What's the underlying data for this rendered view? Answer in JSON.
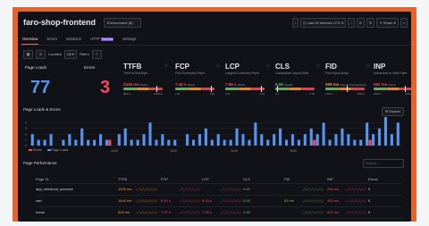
{
  "header": {
    "title": "faro-shop-frontend",
    "environment": "Environment (8)",
    "time_range": "Last 30 minutes",
    "time_zone": "UTC",
    "zoom_label": "−",
    "share_label": "Share",
    "close_label": "×"
  },
  "tabs": [
    {
      "label": "Overview",
      "active": true
    },
    {
      "label": "Errors",
      "active": false
    },
    {
      "label": "Sessions",
      "active": false
    },
    {
      "label": "HTTP",
      "active": false,
      "badge": "Preview"
    },
    {
      "label": "Settings",
      "active": false
    }
  ],
  "filters": {
    "location_label": "Location",
    "location_value": "All",
    "filters_label": "Filters",
    "add_label": "+"
  },
  "summary": {
    "page_loads_label": "Page Loads",
    "page_loads_value": "77",
    "errors_label": "Errors",
    "errors_value": "3"
  },
  "vitals": [
    {
      "name": "TTFB",
      "subtitle": "Time to First Byte",
      "value": "2436 ms",
      "note": "(Poor)",
      "color": "#f2495c",
      "level": 0.85,
      "t1": "800ms",
      "t2": "1800ms"
    },
    {
      "name": "FCP",
      "subtitle": "First Contentful Paint",
      "value": "7.46 s",
      "note": "(Poor)",
      "color": "#f2495c",
      "level": 0.9,
      "t1": "1.8s",
      "t2": "3.0s"
    },
    {
      "name": "LCP",
      "subtitle": "Largest Contentful Paint",
      "value": "7.89 s",
      "note": "(Poor)",
      "color": "#f2495c",
      "level": 0.9,
      "t1": "2.5s",
      "t2": "4.0s"
    },
    {
      "name": "CLS",
      "subtitle": "Cumulative Layout Shift",
      "value": "0.00",
      "note": "(Good)",
      "color": "#73bf69",
      "level": 0.05,
      "t1": "0.1",
      "t2": "0.25"
    },
    {
      "name": "FID",
      "subtitle": "First Input Delay",
      "value": "209 ms",
      "note": "(Needs Improvement)",
      "color": "#ff9830",
      "level": 0.55,
      "t1": "100ms",
      "t2": "300ms"
    },
    {
      "name": "INP",
      "subtitle": "Interaction to Next Paint",
      "value": "592 ms",
      "note": "(Poor)",
      "color": "#f2495c",
      "level": 0.8,
      "t1": "200ms",
      "t2": "500ms"
    }
  ],
  "loads_section": {
    "title": "Page Loads & Errors",
    "explore_label": "Explore",
    "time_labels": [
      "16:20",
      "16:30",
      "16:40",
      "16:50"
    ],
    "legend": [
      {
        "label": "Errors",
        "color": "#f2495c"
      },
      {
        "label": "Page Loads",
        "color": "#5794f2"
      }
    ]
  },
  "chart_data": {
    "type": "bar",
    "title": "Page Loads & Errors",
    "xlabel": "",
    "ylabel": "",
    "yticks": [
      0,
      1,
      2,
      3,
      4
    ],
    "ylim": [
      0,
      5
    ],
    "series": [
      {
        "name": "Page Loads",
        "color": "#5794f2",
        "values": [
          2,
          1,
          1,
          2,
          0,
          1,
          2,
          1,
          3,
          1,
          1,
          2,
          1,
          0,
          2,
          3,
          1,
          1,
          2,
          4,
          1,
          2,
          1,
          1,
          0,
          2,
          1,
          2,
          3,
          1,
          2,
          1,
          1,
          3,
          2,
          1,
          4,
          2,
          1,
          2,
          3,
          1,
          2,
          1,
          2,
          3,
          2,
          4,
          1,
          2,
          3,
          2,
          1,
          1,
          4,
          2,
          3,
          5,
          2,
          4
        ]
      },
      {
        "name": "Errors",
        "color": "#f2495c",
        "values": [
          0,
          0,
          0,
          0,
          0,
          0,
          0,
          0,
          0,
          0,
          0,
          0,
          1,
          0,
          0,
          0,
          0,
          0,
          0,
          0,
          0,
          0,
          0,
          0,
          0,
          0,
          0,
          0,
          0,
          0,
          0,
          0,
          0,
          0,
          0,
          0,
          0,
          0,
          0,
          0,
          0,
          0,
          0,
          0,
          0,
          1,
          0,
          0,
          0,
          0,
          0,
          0,
          0,
          0,
          1,
          0,
          0,
          0,
          0,
          0
        ]
      }
    ]
  },
  "perf_section": {
    "title": "Page Performance",
    "search_placeholder": "Search...",
    "columns": [
      "Page ID",
      "TTFB",
      "FCP",
      "LCP",
      "CLS",
      "FID",
      "INP",
      "Errors"
    ],
    "rows": [
      {
        "page": "app_checkout_success",
        "ttfb": "1430 ms",
        "fcp": "",
        "lcp": "",
        "cls": "0.00",
        "fid": "",
        "inp": "263 ms",
        "errors": "0"
      },
      {
        "page": "cart",
        "ttfb": "1640 ms",
        "fcp": "6.15 s",
        "lcp": "6.15 s",
        "cls": "0.00",
        "fid": "83 ms",
        "inp": "463 ms",
        "errors": "0"
      },
      {
        "page": "home",
        "ttfb": "826 ms",
        "fcp": "7.57 s",
        "lcp": "7.95 s",
        "cls": "0.00",
        "fid": "",
        "inp": "601 ms",
        "errors": "0"
      },
      {
        "page": "product_detail",
        "ttfb": "3161 ms",
        "fcp": "8.64 s",
        "lcp": "8.64 s",
        "cls": "0.00",
        "fid": "187 ms",
        "inp": "",
        "errors": "0"
      }
    ]
  }
}
